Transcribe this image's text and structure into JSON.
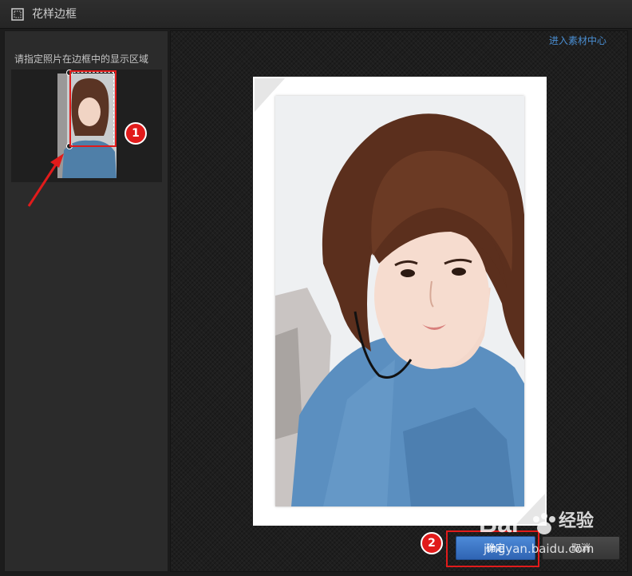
{
  "window": {
    "title": "花样边框",
    "title_icon": "frame-icon"
  },
  "left_panel": {
    "hint": "请指定照片在边框中的显示区域"
  },
  "main": {
    "material_center_link": "进入素材中心"
  },
  "buttons": {
    "ok_label": "确定",
    "cancel_label": "取消"
  },
  "annotations": {
    "badge1": "1",
    "badge2": "2"
  },
  "watermark": {
    "logo": "Bai 百度",
    "word": "经验",
    "url": "jingyan.baidu.com"
  },
  "colors": {
    "accent_blue": "#2f64b3",
    "link_blue": "#4a8fd4",
    "annotation_red": "#e11b1b",
    "background": "#1c1c1c"
  }
}
